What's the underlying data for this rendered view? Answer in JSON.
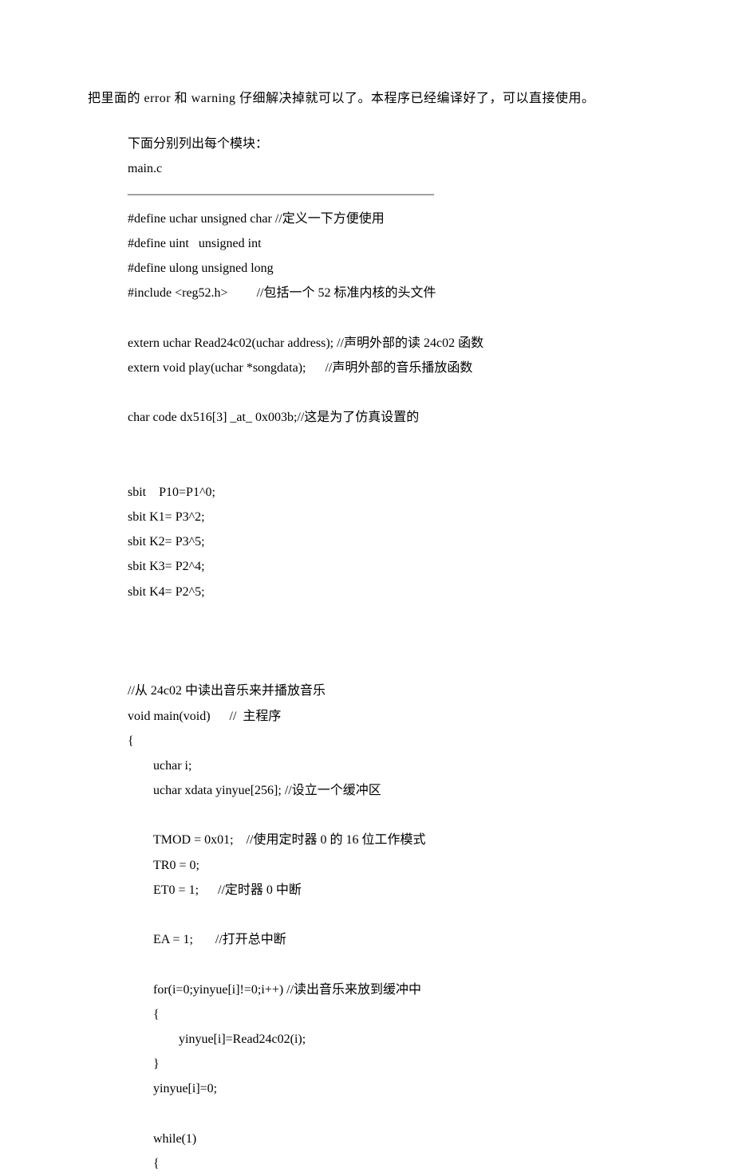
{
  "intro": "把里面的 error 和 warning 仔细解决掉就可以了。本程序已经编译好了，可以直接使用。",
  "lines": [
    "下面分别列出每个模块：",
    "main.c",
    "————————————————————————",
    "#define uchar unsigned char //定义一下方便使用",
    "#define uint   unsigned int",
    "#define ulong unsigned long",
    "#include <reg52.h>         //包括一个 52 标准内核的头文件",
    "",
    "extern uchar Read24c02(uchar address); //声明外部的读 24c02 函数",
    "extern void play(uchar *songdata);      //声明外部的音乐播放函数",
    "",
    "char code dx516[3] _at_ 0x003b;//这是为了仿真设置的",
    "",
    "",
    "sbit    P10=P1^0;",
    "sbit K1= P3^2;",
    "sbit K2= P3^5;",
    "sbit K3= P2^4;",
    "sbit K4= P2^5;",
    "",
    "",
    "",
    "//从 24c02 中读出音乐来并播放音乐",
    "void main(void)      //  主程序",
    "{",
    "        uchar i;",
    "        uchar xdata yinyue[256]; //设立一个缓冲区",
    "",
    "        TMOD = 0x01;    //使用定时器 0 的 16 位工作模式",
    "        TR0 = 0;",
    "        ET0 = 1;      //定时器 0 中断",
    "",
    "        EA = 1;       //打开总中断",
    "",
    "        for(i=0;yinyue[i]!=0;i++) //读出音乐来放到缓冲中",
    "        {",
    "                yinyue[i]=Read24c02(i);",
    "        }",
    "        yinyue[i]=0;",
    "",
    "        while(1)",
    "        {"
  ]
}
